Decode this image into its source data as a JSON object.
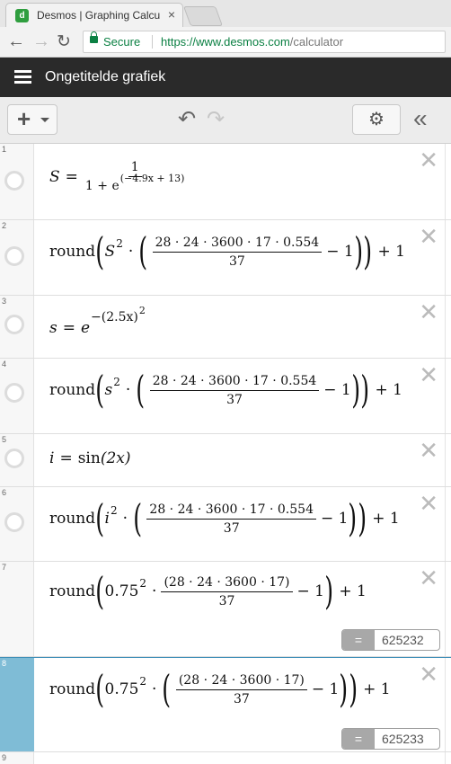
{
  "browser": {
    "tab_title": "Desmos | Graphing Calcu",
    "tab_close": "×",
    "secure_label": "Secure",
    "url_scheme": "https://",
    "url_host": "www.desmos.com",
    "url_path": "/calculator",
    "back_glyph": "←",
    "forward_glyph": "→",
    "reload_glyph": "↻"
  },
  "app": {
    "title": "Ongetitelde grafiek"
  },
  "toolbar": {
    "add_label": "+",
    "undo_glyph": "↶",
    "redo_glyph": "↷",
    "settings_glyph": "⚙",
    "collapse_glyph": "«"
  },
  "colors": {
    "header_bg": "#2a2a2a",
    "selected_gutter": "#7fbcd6",
    "secure_green": "#0b8043"
  },
  "expressions": [
    {
      "num": "1",
      "lhs": "S",
      "eq": "=",
      "frac_num": "1",
      "frac_den_a": "1 + e",
      "frac_den_exp": "(−4.9x + 13)"
    },
    {
      "num": "2",
      "round": "round",
      "base": "S",
      "pow": "2",
      "dot": "·",
      "frac_num": "28 · 24 · 3600 · 17 · 0.554",
      "frac_den": "37",
      "minus_one": "− 1",
      "plus_one": "+ 1"
    },
    {
      "num": "3",
      "lhs": "s",
      "eq": "=",
      "e": "e",
      "exp": "−(2.5x)",
      "exp_pow": "2"
    },
    {
      "num": "4",
      "round": "round",
      "base": "s",
      "pow": "2",
      "dot": "·",
      "frac_num": "28 · 24 · 3600 · 17 · 0.554",
      "frac_den": "37",
      "minus_one": "− 1",
      "plus_one": "+ 1"
    },
    {
      "num": "5",
      "lhs": "i",
      "eq": "=",
      "rhs_fn": "sin",
      "rhs_arg": "(2x)"
    },
    {
      "num": "6",
      "round": "round",
      "base": "i",
      "pow": "2",
      "dot": "·",
      "frac_num": "28 · 24 · 3600 · 17 · 0.554",
      "frac_den": "37",
      "minus_one": "− 1",
      "plus_one": "+ 1"
    },
    {
      "num": "7",
      "round": "round",
      "base": "0.75",
      "pow": "2",
      "dot": "·",
      "frac_num": "(28 · 24 · 3600 · 17)",
      "frac_den": "37",
      "minus_one": "− 1",
      "plus_one": "+ 1",
      "result_eq": "=",
      "result": "625232"
    },
    {
      "num": "8",
      "round": "round",
      "base": "0.75",
      "pow": "2",
      "dot": "·",
      "frac_num": "(28 · 24 · 3600 · 17)",
      "frac_den": "37",
      "minus_one": "− 1",
      "plus_one": "+ 1",
      "result_eq": "=",
      "result": "625233"
    },
    {
      "num": "9"
    }
  ],
  "delete_glyph": "✕"
}
